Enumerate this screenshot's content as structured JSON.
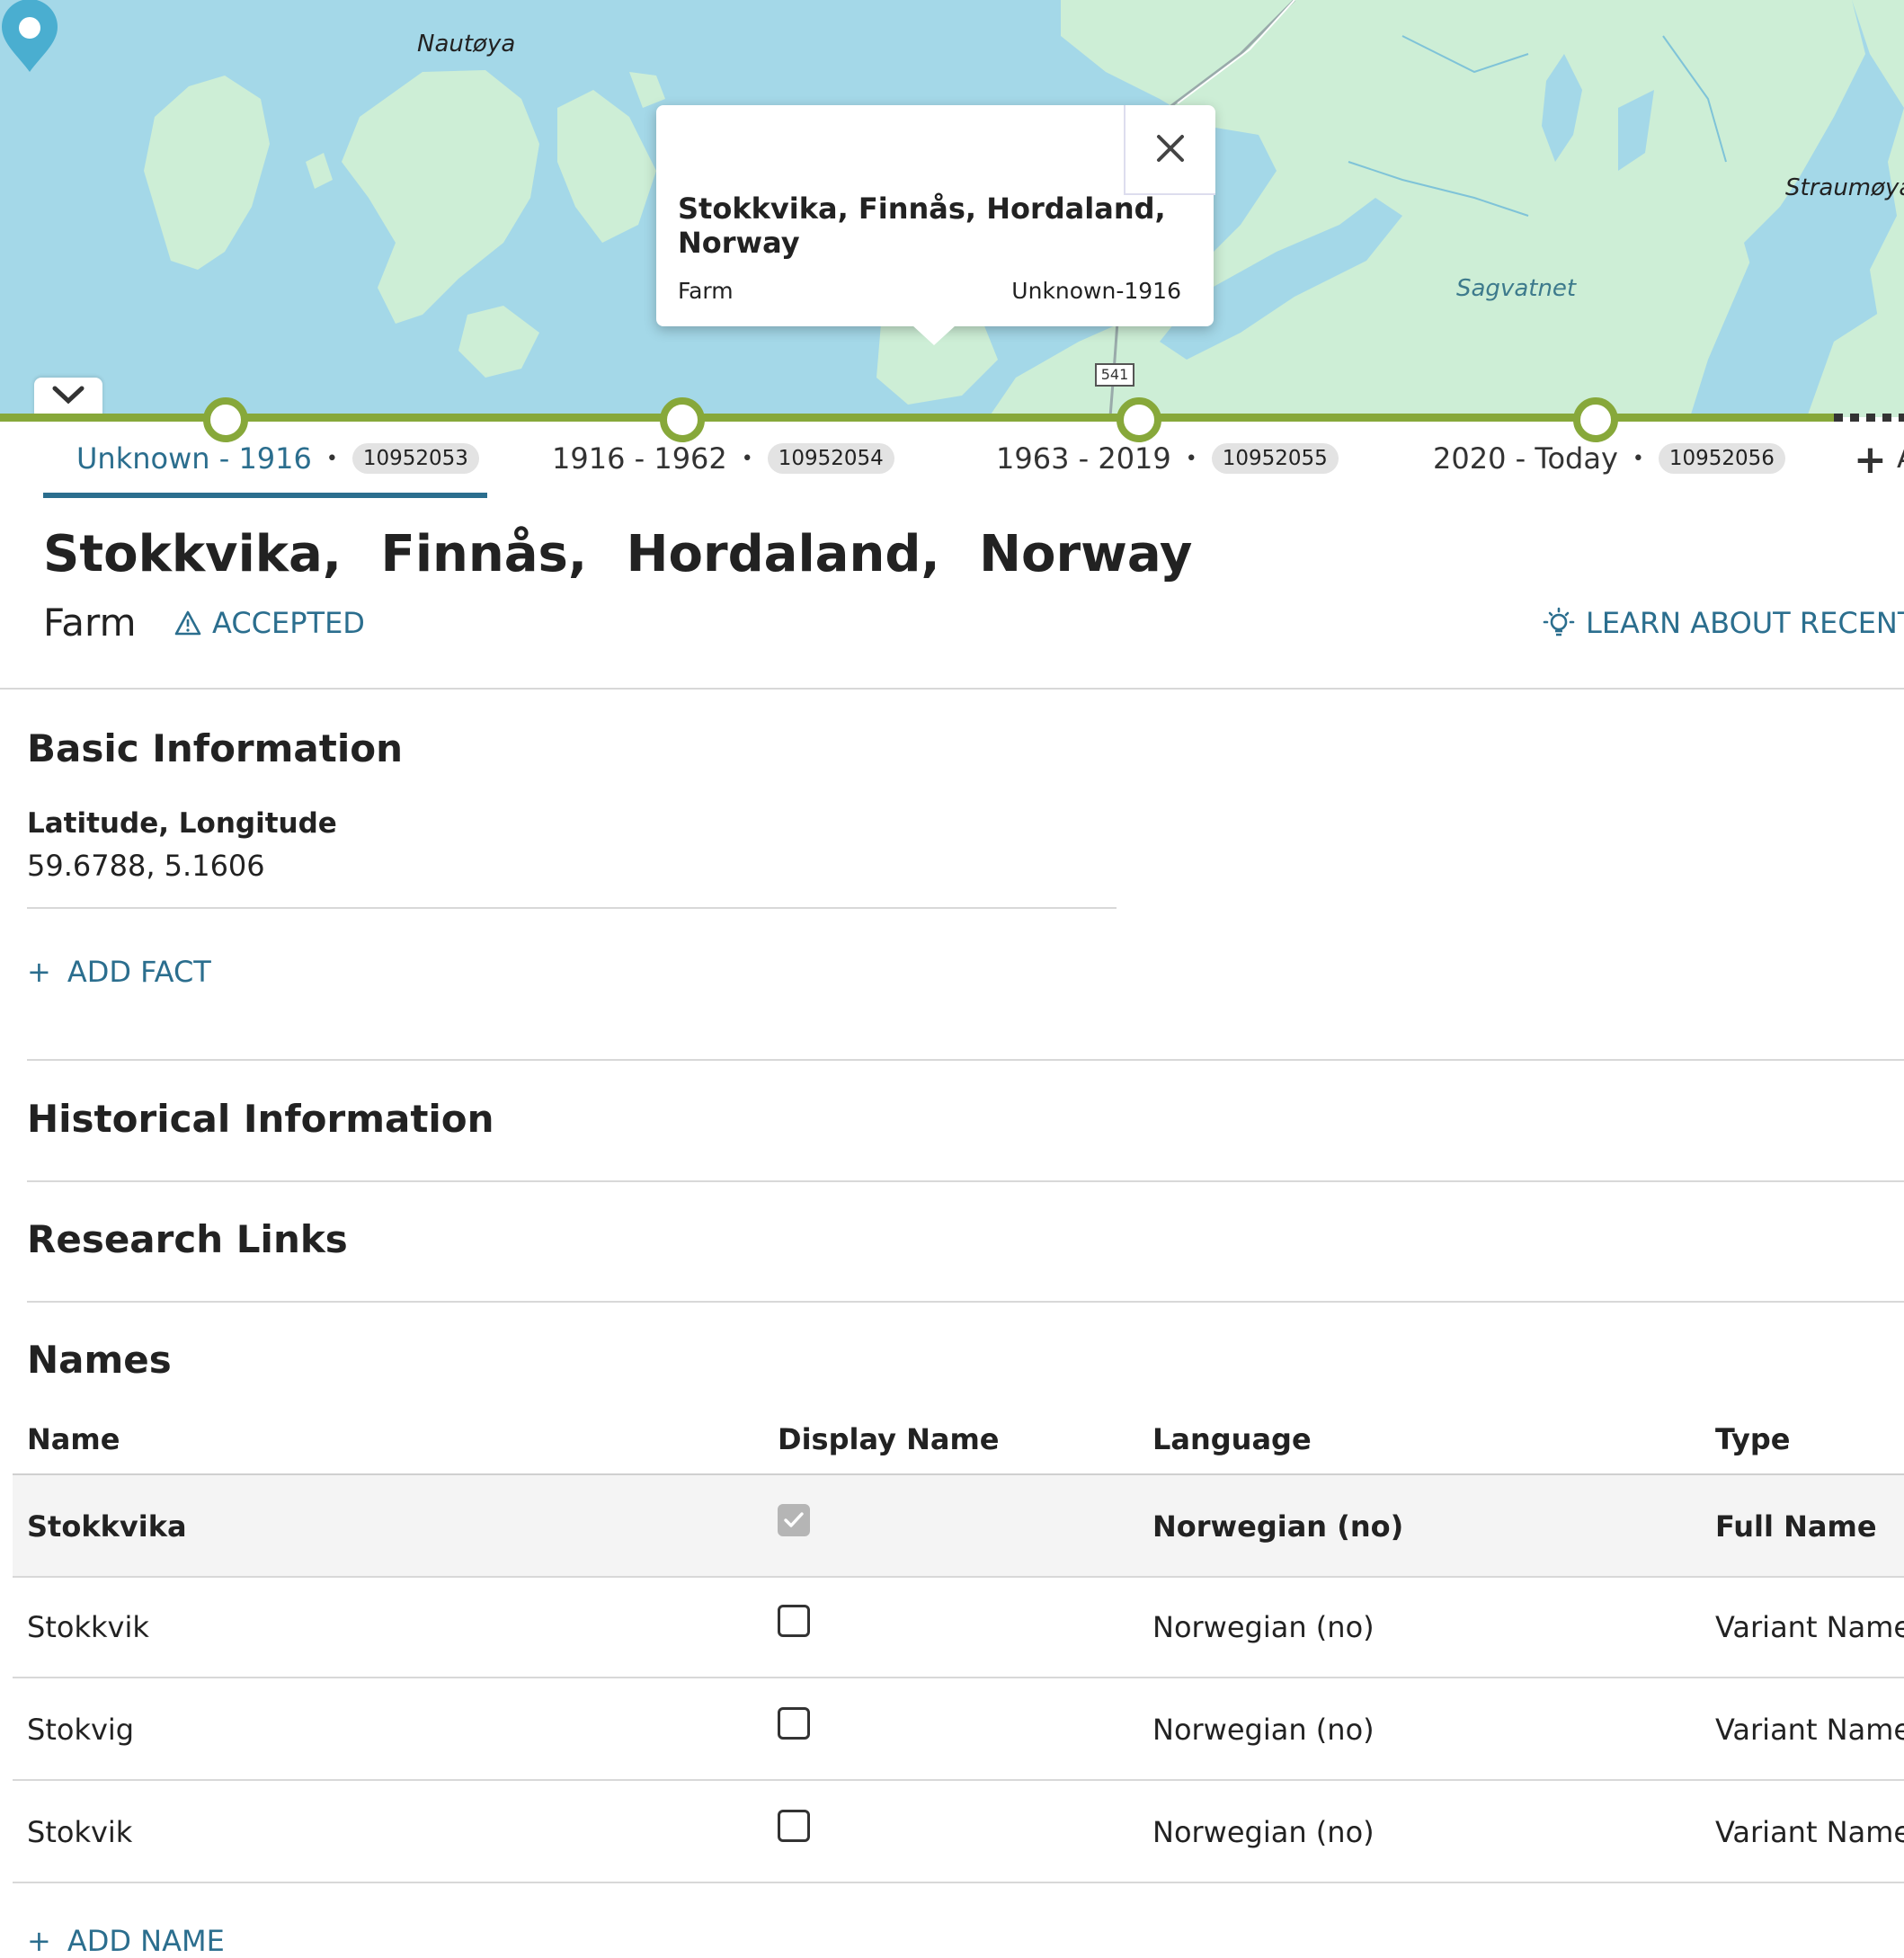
{
  "map": {
    "labels": {
      "island_1": "Nautøya",
      "island_2": "Straumøya",
      "lake": "Sagvatnet"
    },
    "road_number": "541",
    "popup": {
      "title": "Stokkvika, Finnås, Hordaland, Norway",
      "type": "Farm",
      "range": "Unknown-1916"
    }
  },
  "timeline": {
    "tabs": [
      {
        "label": "Unknown - 1916",
        "id": "10952053",
        "active": true
      },
      {
        "label": "1916 - 1962",
        "id": "10952054",
        "active": false
      },
      {
        "label": "1963 - 2019",
        "id": "10952055",
        "active": false
      },
      {
        "label": "2020 - Today",
        "id": "10952056",
        "active": false
      }
    ],
    "add_label": "A"
  },
  "place": {
    "title": "Stokkvika, Finnås, Hordaland, Norway",
    "type": "Farm",
    "status": "ACCEPTED",
    "learn_link": "LEARN ABOUT RECENT"
  },
  "basic_info": {
    "title": "Basic Information",
    "field_label": "Latitude, Longitude",
    "field_value": "59.6788, 5.1606",
    "add_fact": "ADD FACT"
  },
  "historical_info": {
    "title": "Historical Information"
  },
  "research_links": {
    "title": "Research Links"
  },
  "names": {
    "title": "Names",
    "columns": [
      "Name",
      "Display Name",
      "Language",
      "Type"
    ],
    "rows": [
      {
        "name": "Stokkvika",
        "display": true,
        "language": "Norwegian (no)",
        "type": "Full Name"
      },
      {
        "name": "Stokkvik",
        "display": false,
        "language": "Norwegian (no)",
        "type": "Variant Name"
      },
      {
        "name": "Stokvig",
        "display": false,
        "language": "Norwegian (no)",
        "type": "Variant Name"
      },
      {
        "name": "Stokvik",
        "display": false,
        "language": "Norwegian (no)",
        "type": "Variant Name"
      }
    ],
    "add_name": "ADD NAME"
  },
  "colors": {
    "accent": "#2b6e8e",
    "timeline": "#87a83a",
    "water": "#a4d8e8",
    "land": "#cdeed6",
    "pin": "#4aaed0"
  }
}
